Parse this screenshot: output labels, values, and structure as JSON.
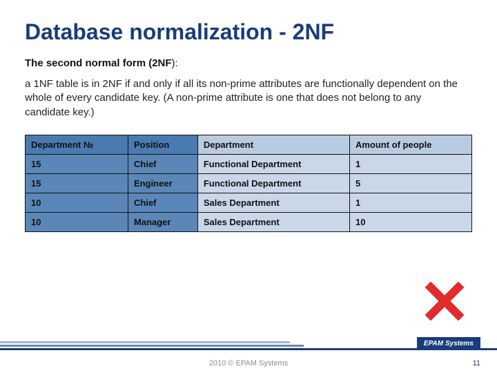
{
  "title": "Database normalization - 2NF",
  "subtitle_prefix": "The second normal form (",
  "subtitle_bold": "2NF",
  "subtitle_suffix": "):",
  "body": "a 1NF table is in 2NF if and only if all its non-prime attributes are functionally dependent on the whole of every candidate key. (A non-prime attribute is one that does not belong to any candidate key.)",
  "table": {
    "headers": [
      "Department №",
      "Position",
      "Department",
      "Amount of people"
    ],
    "rows": [
      [
        "15",
        "Chief",
        "Functional Department",
        "1"
      ],
      [
        "15",
        "Engineer",
        "Functional Department",
        "5"
      ],
      [
        "10",
        "Chief",
        "Sales Department",
        "1"
      ],
      [
        "10",
        "Manager",
        "Sales Department",
        "10"
      ]
    ]
  },
  "footer": {
    "badge": "EPAM Systems",
    "copyright": "2010 © EPAM Systems",
    "page": "11"
  },
  "colors": {
    "title": "#1a3c7a",
    "col_blue": "#5a87b8",
    "col_light": "#c9d7e8",
    "cross": "#e22b2b"
  }
}
